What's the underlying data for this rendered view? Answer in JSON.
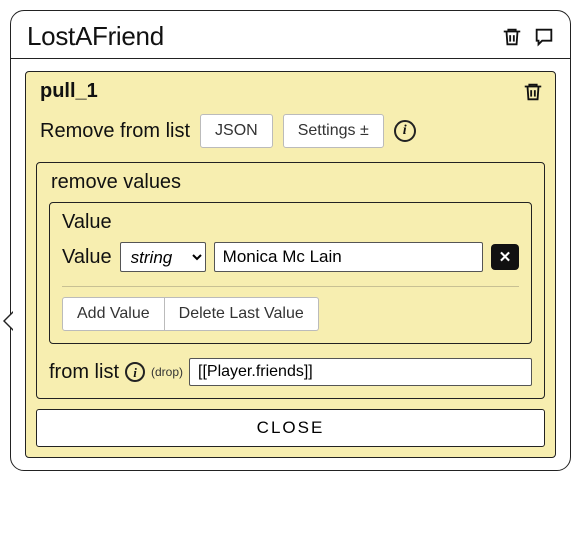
{
  "window": {
    "title": "LostAFriend"
  },
  "panel": {
    "id": "pull_1",
    "action_label": "Remove from list",
    "json_btn": "JSON",
    "settings_btn": "Settings ±"
  },
  "remove_section": {
    "title": "remove values",
    "value_box_title": "Value",
    "value_label": "Value",
    "type_options": [
      "string"
    ],
    "type_selected": "string",
    "value_text": "Monica Mc Lain",
    "add_btn": "Add Value",
    "delete_btn": "Delete Last Value",
    "from_label": "from list",
    "drop_hint": "(drop)",
    "list_value": "[[Player.friends]]"
  },
  "close_label": "CLOSE"
}
